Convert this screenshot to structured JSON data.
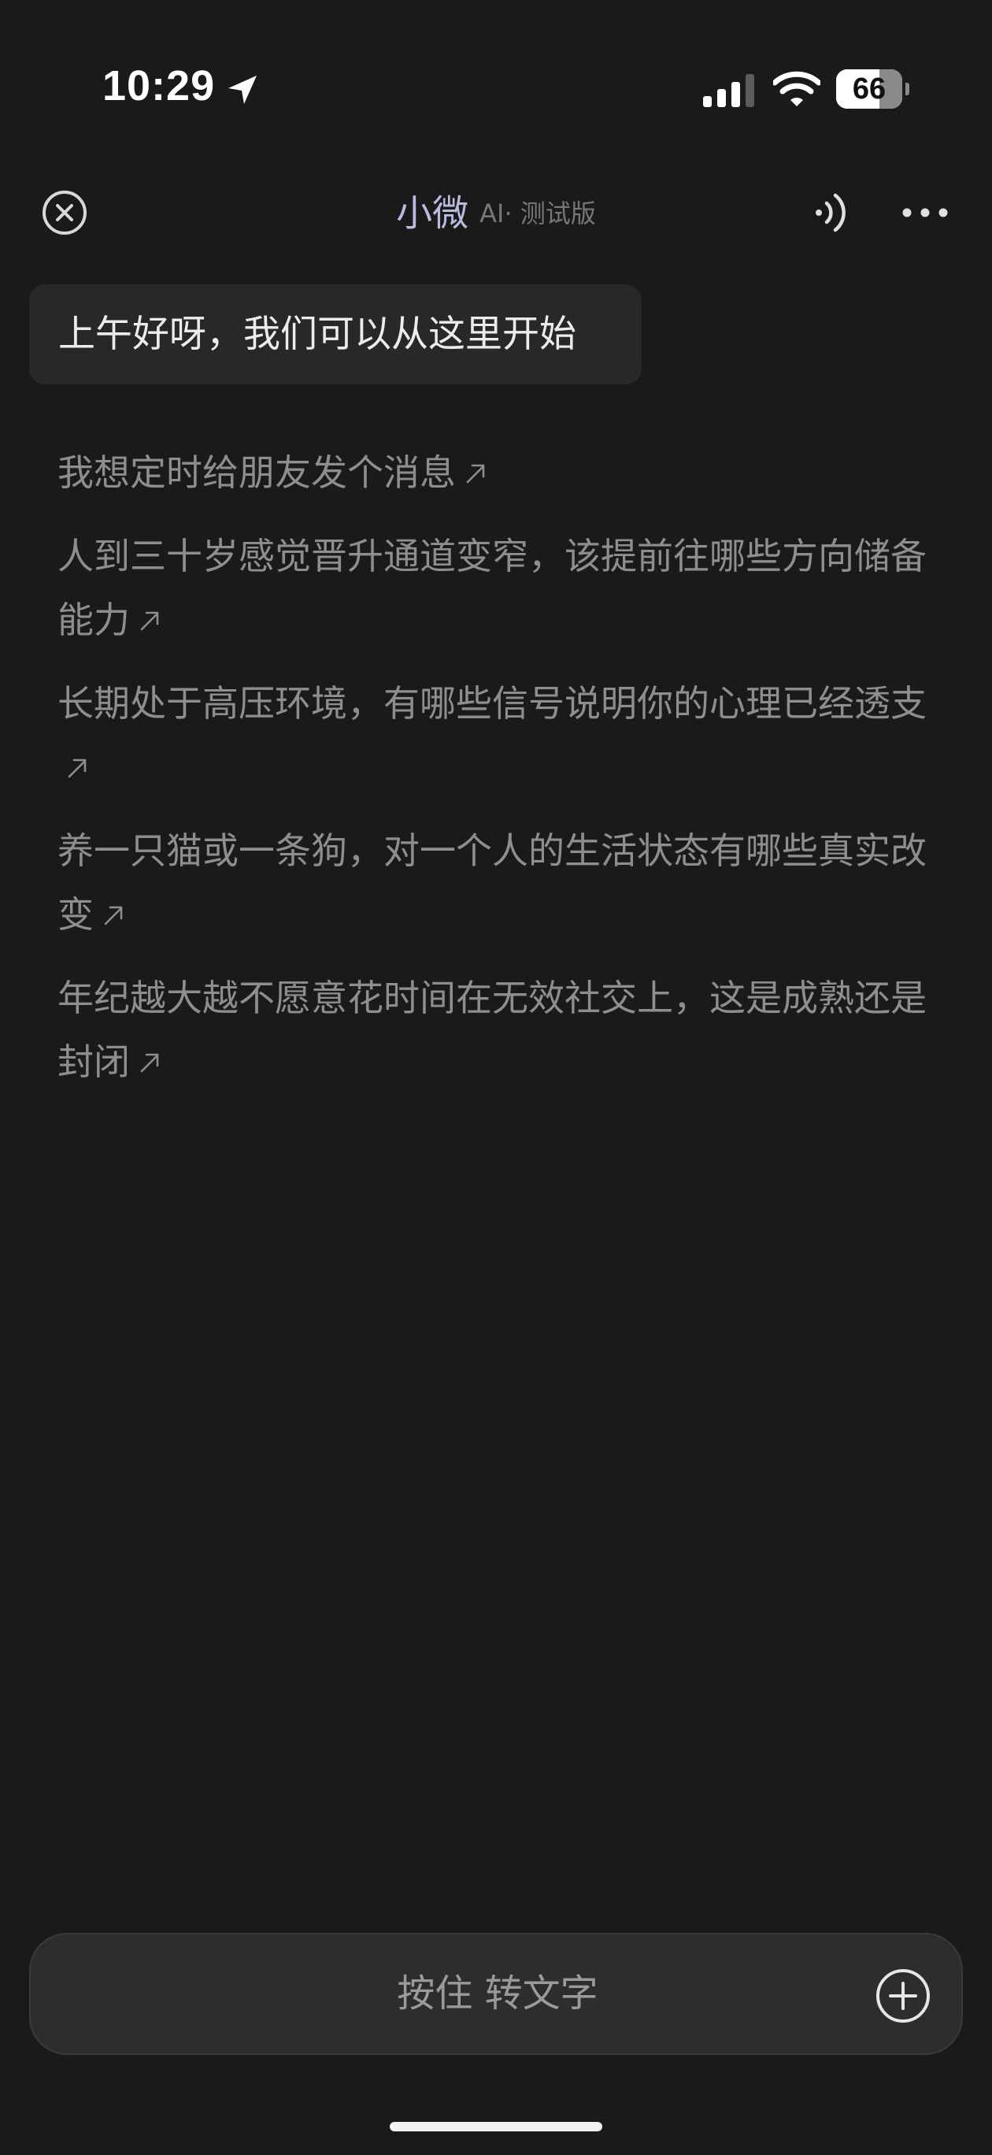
{
  "status_bar": {
    "time": "10:29",
    "battery_percent": "66",
    "battery_level": 0.66,
    "icons": [
      "location-arrow-icon",
      "cellular-signal-icon",
      "wifi-icon",
      "battery-icon"
    ]
  },
  "header": {
    "title": "小微",
    "subtitle": "AI· 测试版",
    "icons": [
      "close-circle-icon",
      "speaker-icon",
      "more-icon"
    ]
  },
  "greeting": "上午好呀，我们可以从这里开始",
  "suggestions": [
    {
      "text": "我想定时给朋友发个消息",
      "icon": "arrow-up-right-icon"
    },
    {
      "text": "人到三十岁感觉晋升通道变窄，该提前往哪些方向储备能力",
      "icon": "arrow-up-right-icon"
    },
    {
      "text": "长期处于高压环境，有哪些信号说明你的心理已经透支",
      "icon": "arrow-up-right-icon"
    },
    {
      "text": "养一只猫或一条狗，对一个人的生活状态有哪些真实改变",
      "icon": "arrow-up-right-icon"
    },
    {
      "text": "年纪越大越不愿意花时间在无效社交上，这是成熟还是封闭",
      "icon": "arrow-up-right-icon"
    }
  ],
  "input": {
    "label": "按住 转文字",
    "icon": "plus-circle-icon"
  },
  "colors": {
    "background": "#1a1a1a",
    "title": "#b9bbe0",
    "suggestion_text": "#8e8e8e",
    "bubble": "#282828",
    "input_bar": "#2d2d2d"
  }
}
